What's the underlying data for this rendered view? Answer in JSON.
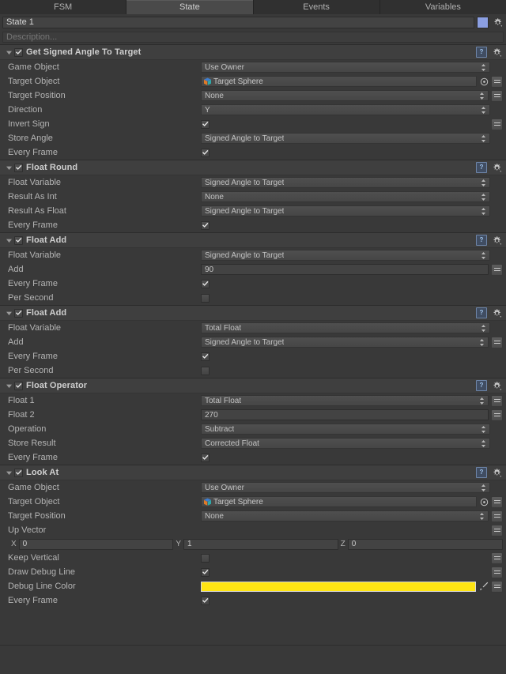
{
  "tabs": [
    {
      "label": "FSM",
      "active": false
    },
    {
      "label": "State",
      "active": true
    },
    {
      "label": "Events",
      "active": false
    },
    {
      "label": "Variables",
      "active": false
    }
  ],
  "state": {
    "name": "State 1",
    "description_placeholder": "Description...",
    "color": "#8b9fe2",
    "settings_icon": "gear-icon"
  },
  "colors": {
    "debug_line": "#ffe513",
    "state_swatch": "#8b9fe2",
    "background": "#393939",
    "header": "#3f3f3f"
  },
  "actions": [
    {
      "title": "Get Signed Angle To Target",
      "enabled": true,
      "expanded": true,
      "rows": [
        {
          "label": "Game Object",
          "type": "popup",
          "value": "Use Owner",
          "menu": false
        },
        {
          "label": "Target Object",
          "type": "object",
          "value": "Target Sphere",
          "menu": true
        },
        {
          "label": "Target Position",
          "type": "popup",
          "value": "None",
          "menu": true
        },
        {
          "label": "Direction",
          "type": "popup",
          "value": "Y",
          "menu": false
        },
        {
          "label": "Invert Sign",
          "type": "checkbox",
          "checked": true,
          "menu": true
        },
        {
          "label": "Store Angle",
          "type": "popup",
          "value": "Signed Angle to Target",
          "menu": false
        },
        {
          "label": "Every Frame",
          "type": "checkbox",
          "checked": true,
          "menu": false
        }
      ]
    },
    {
      "title": "Float Round",
      "enabled": true,
      "expanded": true,
      "rows": [
        {
          "label": "Float Variable",
          "type": "popup",
          "value": "Signed Angle to Target",
          "menu": false
        },
        {
          "label": "Result As Int",
          "type": "popup",
          "value": "None",
          "menu": false
        },
        {
          "label": "Result As Float",
          "type": "popup",
          "value": "Signed Angle to Target",
          "menu": false
        },
        {
          "label": "Every Frame",
          "type": "checkbox",
          "checked": true,
          "menu": false
        }
      ]
    },
    {
      "title": "Float Add",
      "enabled": true,
      "expanded": true,
      "rows": [
        {
          "label": "Float Variable",
          "type": "popup",
          "value": "Signed Angle to Target",
          "menu": false
        },
        {
          "label": "Add",
          "type": "text",
          "value": "90",
          "menu": true
        },
        {
          "label": "Every Frame",
          "type": "checkbox",
          "checked": true,
          "menu": false
        },
        {
          "label": "Per Second",
          "type": "checkbox",
          "checked": false,
          "menu": false
        }
      ]
    },
    {
      "title": "Float Add",
      "enabled": true,
      "expanded": true,
      "rows": [
        {
          "label": "Float Variable",
          "type": "popup",
          "value": "Total Float",
          "menu": false
        },
        {
          "label": "Add",
          "type": "popup",
          "value": "Signed Angle to Target",
          "menu": true
        },
        {
          "label": "Every Frame",
          "type": "checkbox",
          "checked": true,
          "menu": false
        },
        {
          "label": "Per Second",
          "type": "checkbox",
          "checked": false,
          "menu": false
        }
      ]
    },
    {
      "title": "Float Operator",
      "enabled": true,
      "expanded": true,
      "rows": [
        {
          "label": "Float 1",
          "type": "popup",
          "value": "Total Float",
          "menu": true
        },
        {
          "label": "Float 2",
          "type": "text",
          "value": "270",
          "menu": true
        },
        {
          "label": "Operation",
          "type": "popup",
          "value": "Subtract",
          "menu": false
        },
        {
          "label": "Store Result",
          "type": "popup",
          "value": "Corrected Float",
          "menu": false
        },
        {
          "label": "Every Frame",
          "type": "checkbox",
          "checked": true,
          "menu": false
        }
      ]
    },
    {
      "title": "Look At",
      "enabled": true,
      "expanded": true,
      "rows": [
        {
          "label": "Game Object",
          "type": "popup",
          "value": "Use Owner",
          "menu": false
        },
        {
          "label": "Target Object",
          "type": "object",
          "value": "Target Sphere",
          "menu": true
        },
        {
          "label": "Target Position",
          "type": "popup",
          "value": "None",
          "menu": true
        },
        {
          "label": "Up Vector",
          "type": "vectorlabel",
          "menu": true
        },
        {
          "label": "",
          "type": "vector",
          "x_label": "X",
          "x": "0",
          "y_label": "Y",
          "y": "1",
          "z_label": "Z",
          "z": "0"
        },
        {
          "label": "Keep Vertical",
          "type": "checkbox",
          "checked": false,
          "menu": true
        },
        {
          "label": "Draw Debug Line",
          "type": "checkbox",
          "checked": true,
          "menu": true
        },
        {
          "label": "Debug Line Color",
          "type": "color",
          "value": "#ffe513",
          "menu": true
        },
        {
          "label": "Every Frame",
          "type": "checkbox",
          "checked": true,
          "menu": false
        }
      ]
    }
  ]
}
